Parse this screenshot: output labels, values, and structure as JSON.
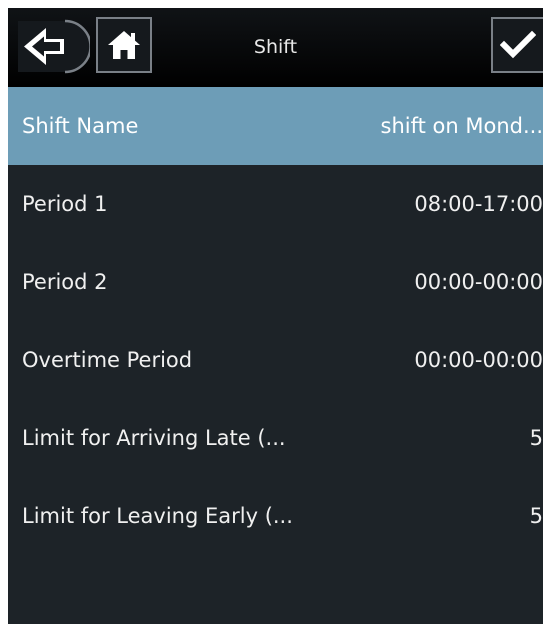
{
  "header": {
    "title": "Shift",
    "back_icon": "back-arrow-icon",
    "home_icon": "home-icon",
    "confirm_icon": "checkmark-icon"
  },
  "rows": [
    {
      "label": "Shift Name",
      "value": "shift on Mond...",
      "selected": true
    },
    {
      "label": "Period 1",
      "value": "08:00-17:00",
      "selected": false
    },
    {
      "label": "Period 2",
      "value": "00:00-00:00",
      "selected": false
    },
    {
      "label": "Overtime Period",
      "value": "00:00-00:00",
      "selected": false
    },
    {
      "label": "Limit for Arriving Late (...",
      "value": "5",
      "selected": false
    },
    {
      "label": "Limit for Leaving Early (...",
      "value": "5",
      "selected": false
    }
  ],
  "colors": {
    "background": "#1d2328",
    "header": "#000000",
    "selected_row": "#6d9db7",
    "text": "#ffffff"
  }
}
